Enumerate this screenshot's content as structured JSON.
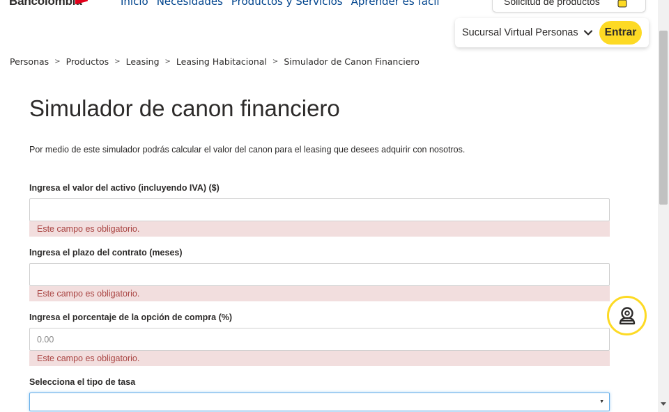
{
  "header": {
    "brand": "Bancolombia",
    "nav": [
      "Inicio",
      "Necesidades",
      "Productos y Servicios",
      "Aprender es fácil"
    ],
    "solicitud_label": "Solicitud de productos",
    "sucursal_label": "Sucursal Virtual Personas",
    "entrar_label": "Entrar"
  },
  "breadcrumb": {
    "items": [
      "Personas",
      "Productos",
      "Leasing",
      "Leasing Habitacional",
      "Simulador de Canon Financiero"
    ],
    "separator": ">"
  },
  "main": {
    "title": "Simulador de canon financiero",
    "intro": "Por medio de este simulador podrás calcular el valor del canon para el leasing que desees adquirir con nosotros.",
    "fields": [
      {
        "label": "Ingresa el valor del activo (incluyendo IVA) ($)",
        "value": "",
        "placeholder": "",
        "error": "Este campo es obligatorio."
      },
      {
        "label": "Ingresa el plazo del contrato (meses)",
        "value": "",
        "placeholder": "",
        "error": "Este campo es obligatorio."
      },
      {
        "label": "Ingresa el porcentaje de la opción de compra (%)",
        "value": "",
        "placeholder": "0.00",
        "error": "Este campo es obligatorio."
      }
    ],
    "tasa": {
      "label": "Selecciona el tipo de tasa",
      "selected": ""
    }
  },
  "icons": {
    "sucursal_chevron": "chevron-down-icon",
    "solicitud": "shopping-bag-icon",
    "help": "chat-support-icon",
    "select_arrow": "caret-down-icon"
  },
  "colors": {
    "brand_yellow": "#fdda24",
    "link_blue": "#00448d",
    "error_bg": "#f2dede",
    "error_text": "#a94442",
    "focus_border": "#66afe9"
  }
}
